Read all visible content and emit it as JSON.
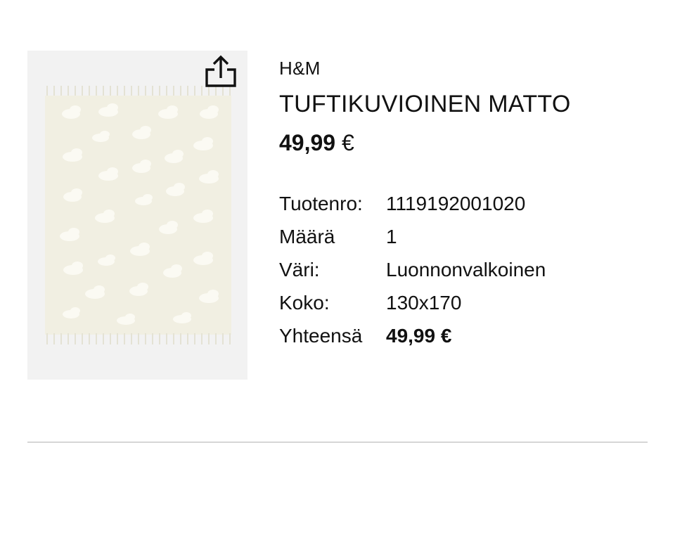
{
  "product": {
    "image_alt": "Tuftattu pilvikuvioinen matto",
    "share_icon": "share-icon",
    "brand": "H&M",
    "name": "TUFTIKUVIOINEN MATTO",
    "price": "49,99",
    "price_currency": "€"
  },
  "details": [
    {
      "label": "Tuotenro:",
      "value": "1119192001020"
    },
    {
      "label": "Määrä",
      "value": "1"
    },
    {
      "label": "Väri:",
      "value": "Luonnonvalkoinen"
    },
    {
      "label": "Koko:",
      "value": "130x170"
    },
    {
      "label": "Yhteensä",
      "value": "49,99 €"
    }
  ],
  "colors": {
    "rug": "#f1efe2",
    "cloud": "#fbfaf3",
    "background": "#f2f2f2",
    "divider": "#d6d6d6"
  }
}
